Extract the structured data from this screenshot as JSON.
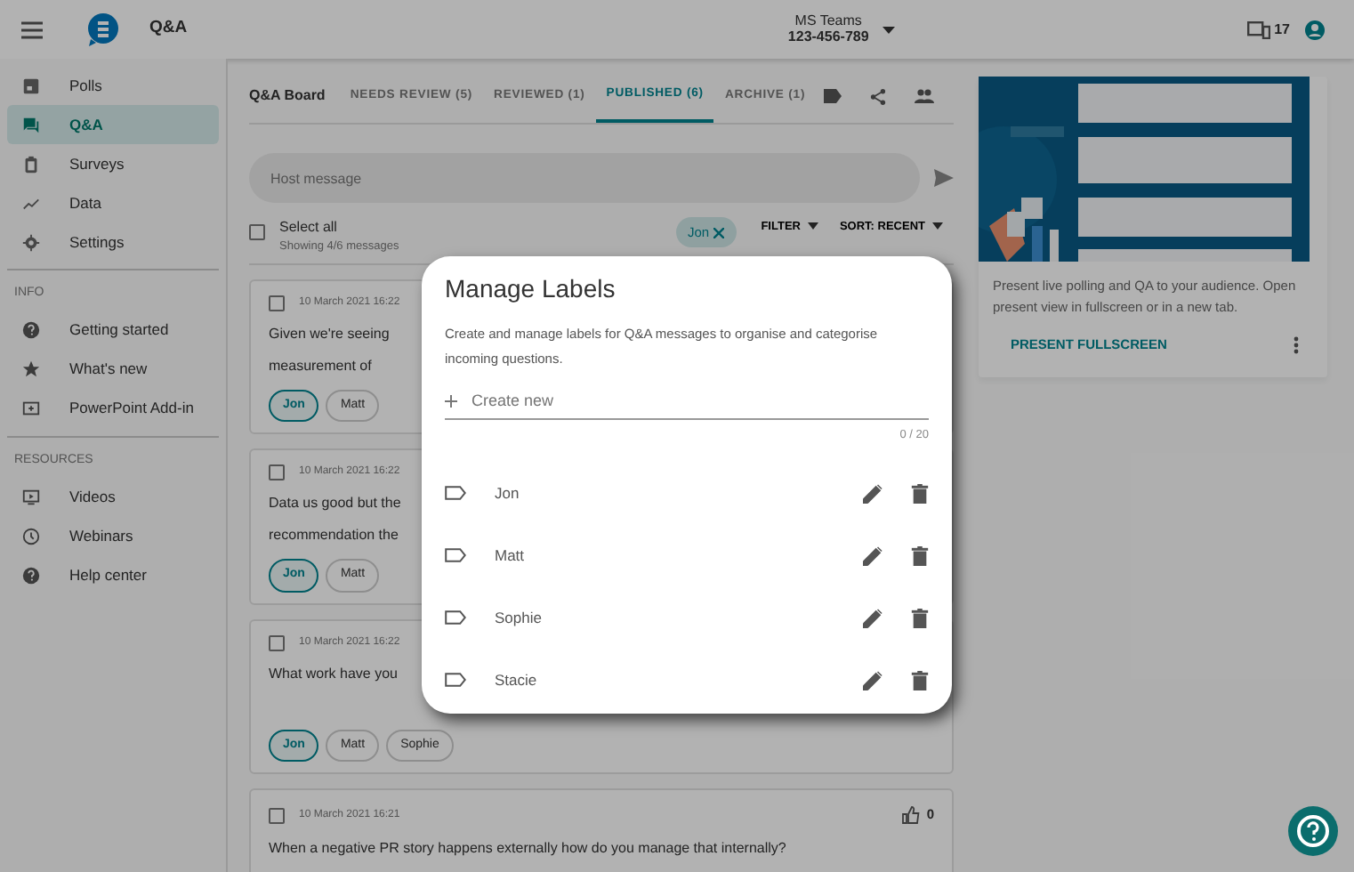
{
  "app": {
    "title": "Q&A",
    "event": "MS Teams",
    "event_code": "123-456-789",
    "device_count": "17"
  },
  "sidebar": {
    "items": [
      {
        "label": "Polls",
        "selected": false
      },
      {
        "label": "Q&A",
        "selected": true
      },
      {
        "label": "Surveys",
        "selected": false
      },
      {
        "label": "Data",
        "selected": false
      },
      {
        "label": "Settings",
        "selected": false
      }
    ],
    "sections": [
      {
        "heading": "INFO",
        "items": [
          {
            "label": "Getting started"
          },
          {
            "label": "What's new"
          },
          {
            "label": "PowerPoint Add-in"
          }
        ]
      },
      {
        "heading": "RESOURCES",
        "items": [
          {
            "label": "Videos"
          },
          {
            "label": "Webinars"
          },
          {
            "label": "Help center"
          }
        ]
      }
    ]
  },
  "board": {
    "title": "Q&A Board",
    "tabs": [
      {
        "label": "NEEDS REVIEW (5)",
        "selected": false
      },
      {
        "label": "REVIEWED (1)",
        "selected": false
      },
      {
        "label": "PUBLISHED (6)",
        "selected": true
      },
      {
        "label": "ARCHIVE (1)",
        "selected": false
      }
    ],
    "message_placeholder": "Host message",
    "select_all": "Select all",
    "select_all_checked": false,
    "showing": "Showing 4/6 messages",
    "filter_chip": "Jon",
    "filter": "FILTER",
    "sort": "SORT: RECENT",
    "messages": [
      {
        "checked": false,
        "date": "10 March 2021 16:22",
        "lines": [
          "Given we're seeing",
          "measurement of"
        ],
        "tags": [
          {
            "label": "Jon",
            "selected": true
          },
          {
            "label": "Matt",
            "selected": false
          }
        ]
      },
      {
        "checked": false,
        "date": "10 March 2021 16:22",
        "lines": [
          "Data us good but the",
          "recommendation the"
        ],
        "tags": [
          {
            "label": "Jon",
            "selected": true
          },
          {
            "label": "Matt",
            "selected": false
          }
        ]
      },
      {
        "checked": false,
        "date": "10 March 2021 16:22",
        "lines": [
          "What work have you"
        ],
        "tags": [
          {
            "label": "Jon",
            "selected": true
          },
          {
            "label": "Matt",
            "selected": false
          },
          {
            "label": "Sophie",
            "selected": false
          }
        ]
      },
      {
        "checked": false,
        "date": "10 March 2021 16:21",
        "likes": "0",
        "lines": [
          "When a negative PR story happens externally how do you manage that internally?"
        ]
      }
    ]
  },
  "present": {
    "description": "Present live polling and QA to your audience. Open present view in fullscreen or in a new tab.",
    "button": "PRESENT FULLSCREEN"
  },
  "dialog": {
    "title": "Manage Labels",
    "description": "Create and manage labels for Q&A messages to organise and categorise incoming questions.",
    "placeholder": "Create new",
    "counter": "0 / 20",
    "labels": [
      "Jon",
      "Matt",
      "Sophie",
      "Stacie"
    ]
  }
}
